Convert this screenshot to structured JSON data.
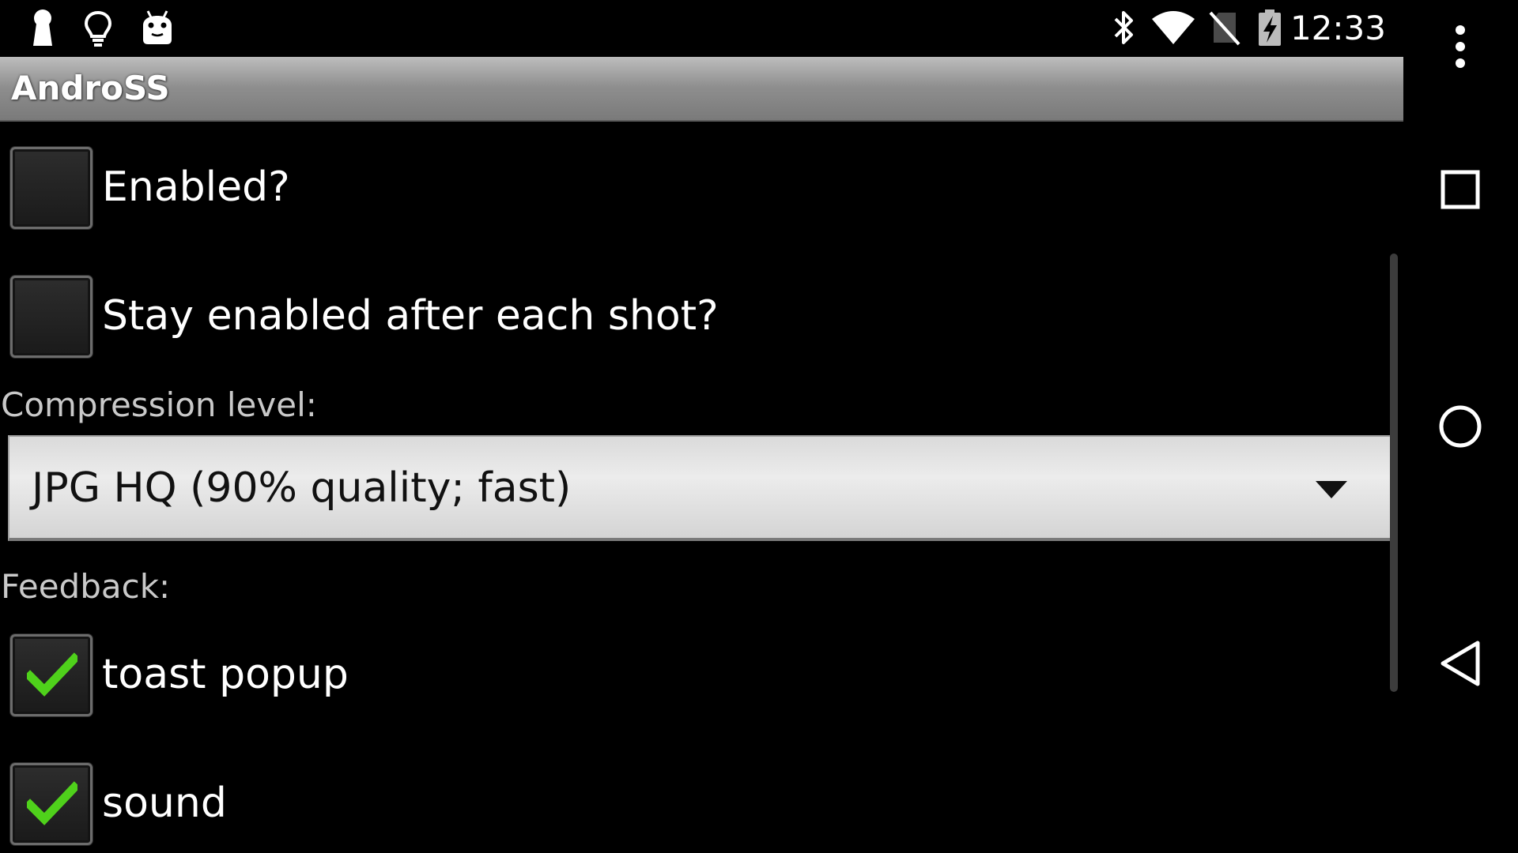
{
  "status_bar": {
    "left_icons": [
      "keyhole-icon",
      "lightbulb-icon",
      "android-icon"
    ],
    "right_icons": [
      "bluetooth-icon",
      "wifi-icon",
      "no-sim-icon",
      "battery-charging-icon"
    ],
    "time": "12:33"
  },
  "title_bar": {
    "title": "AndroSS"
  },
  "settings": {
    "enabled": {
      "label": "Enabled?",
      "checked": false
    },
    "stay_enabled": {
      "label": "Stay enabled after each shot?",
      "checked": false
    },
    "compression": {
      "label": "Compression level:",
      "selected": "JPG HQ (90% quality; fast)"
    },
    "feedback": {
      "label": "Feedback:",
      "toast": {
        "label": "toast popup",
        "checked": true
      },
      "sound": {
        "label": "sound",
        "checked": true
      }
    }
  },
  "nav_bar": {
    "buttons": [
      "overflow-menu-icon",
      "recents-icon",
      "home-icon",
      "back-icon"
    ]
  },
  "colors": {
    "check_green": "#4fd11b",
    "title_gradient_top": "#bdbdbd",
    "title_gradient_bottom": "#7a7a7a",
    "section_label": "#c9c9c9"
  }
}
